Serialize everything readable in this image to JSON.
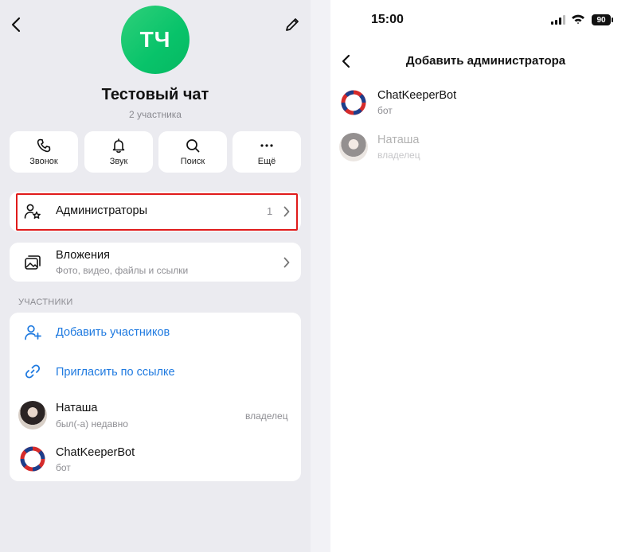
{
  "left_panel": {
    "avatar_initials": "ТЧ",
    "chat_title": "Тестовый чат",
    "chat_subtitle": "2 участника",
    "actions": [
      {
        "label": "Звонок",
        "icon": "phone-icon"
      },
      {
        "label": "Звук",
        "icon": "bell-icon"
      },
      {
        "label": "Поиск",
        "icon": "search-icon"
      },
      {
        "label": "Ещё",
        "icon": "more-icon"
      }
    ],
    "admins_row": {
      "label": "Администраторы",
      "count": "1"
    },
    "attachments_row": {
      "label": "Вложения",
      "subtitle": "Фото, видео, файлы и ссылки"
    },
    "members_section_title": "УЧАСТНИКИ",
    "add_members_label": "Добавить участников",
    "invite_link_label": "Пригласить по ссылке",
    "members": [
      {
        "name": "Наташа",
        "status": "был(-а) недавно",
        "role": "владелец"
      },
      {
        "name": "ChatKeeperBot",
        "status": "бот",
        "role": ""
      }
    ]
  },
  "right_panel": {
    "status_time": "15:00",
    "battery": "90",
    "title": "Добавить администратора",
    "candidates": [
      {
        "name": "ChatKeeperBot",
        "subtitle": "бот",
        "disabled": false
      },
      {
        "name": "Наташа",
        "subtitle": "владелец",
        "disabled": true
      }
    ]
  },
  "colors": {
    "accent": "#1f7ae0",
    "highlight": "#e01b1b",
    "avatar_green": "#08c36a"
  }
}
